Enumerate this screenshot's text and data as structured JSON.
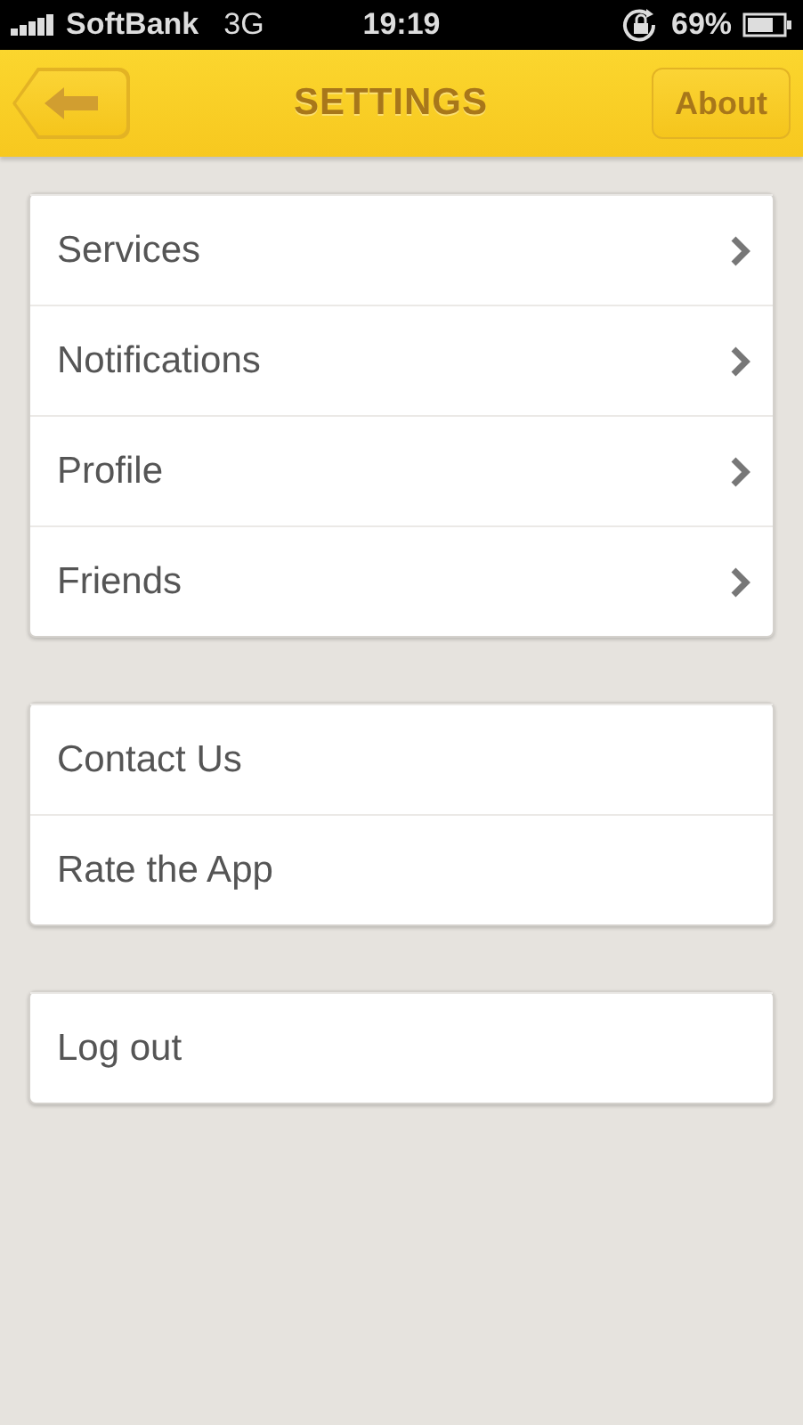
{
  "status_bar": {
    "carrier": "SoftBank",
    "network": "3G",
    "time": "19:19",
    "battery": "69%"
  },
  "nav_bar": {
    "title": "SETTINGS",
    "right_button": "About"
  },
  "groups": [
    {
      "items": [
        {
          "label": "Services",
          "chevron": true
        },
        {
          "label": "Notifications",
          "chevron": true
        },
        {
          "label": "Profile",
          "chevron": true
        },
        {
          "label": "Friends",
          "chevron": true
        }
      ]
    },
    {
      "items": [
        {
          "label": "Contact Us",
          "chevron": false
        },
        {
          "label": "Rate the App",
          "chevron": false
        }
      ]
    },
    {
      "items": [
        {
          "label": "Log out",
          "chevron": false
        }
      ]
    }
  ]
}
